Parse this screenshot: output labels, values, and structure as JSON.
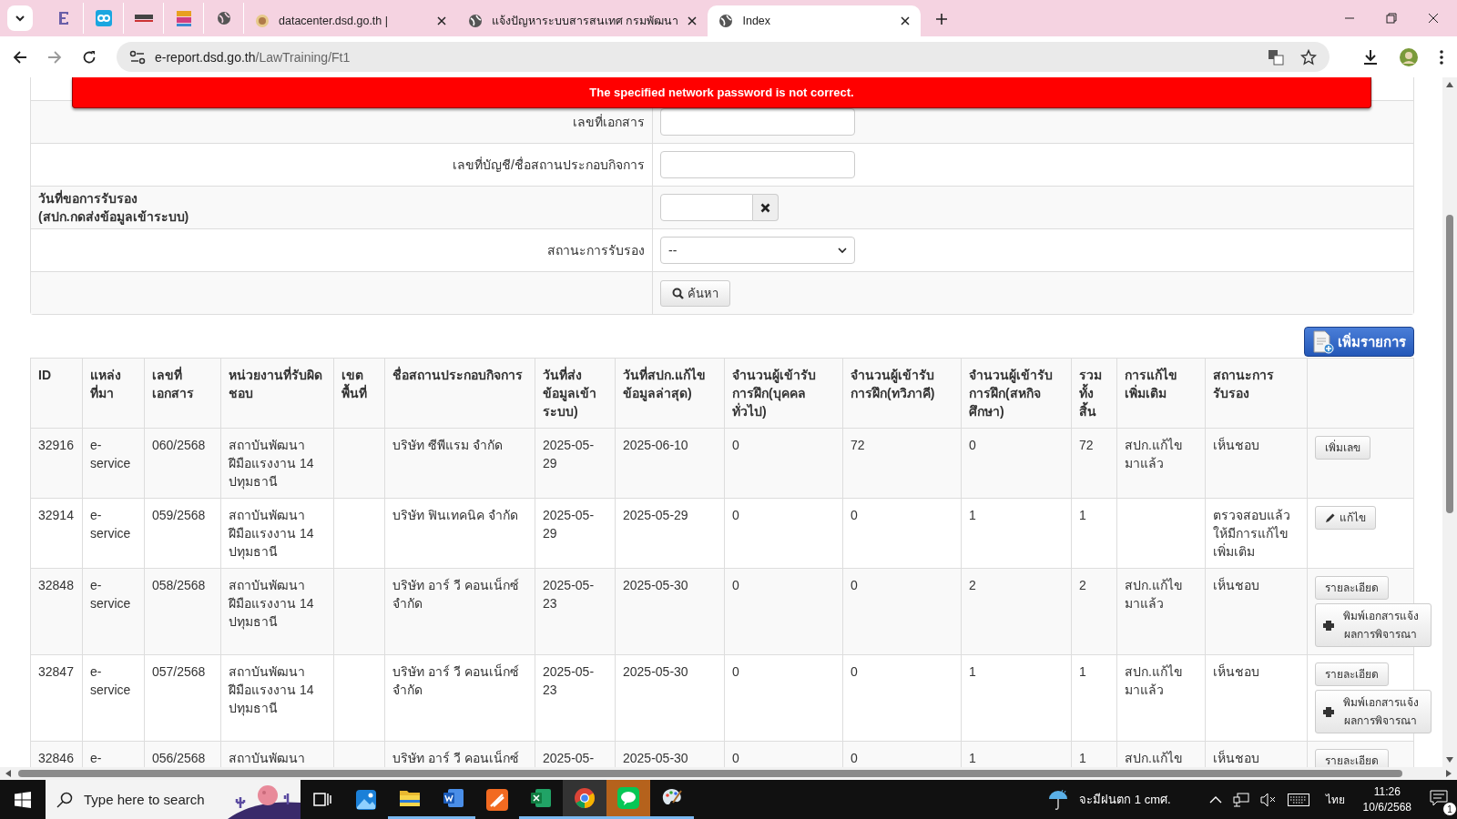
{
  "browser": {
    "tabs": [
      {
        "kind": "pinned",
        "selected": false
      },
      {
        "kind": "pinned",
        "selected": false
      },
      {
        "kind": "pinned",
        "selected": false
      },
      {
        "kind": "pinned",
        "selected": false
      },
      {
        "kind": "pinned",
        "selected": false
      },
      {
        "kind": "page",
        "title": "datacenter.dsd.go.th |",
        "selected": false
      },
      {
        "kind": "page",
        "title": "แจ้งปัญหาระบบสารสนเทศ กรมพัฒนา",
        "selected": false
      },
      {
        "kind": "page",
        "title": "Index",
        "selected": true
      }
    ],
    "url": {
      "host": "e-report.dsd.go.th",
      "path": "/LawTraining/Ft1"
    }
  },
  "alert": {
    "message": "The specified network password is not correct."
  },
  "form": {
    "rows": [
      {
        "kind": "text",
        "label_lines": [
          "เลขที่เอกสาร"
        ],
        "value": ""
      },
      {
        "kind": "text",
        "label_lines": [
          "เลขที่บัญชี/ชื่อสถานประกอบกิจการ"
        ],
        "value": ""
      },
      {
        "kind": "date",
        "label_lines": [
          "วันที่ขอการรับรอง",
          "(สปก.กดส่งข้อมูลเข้าระบบ)"
        ],
        "value": ""
      },
      {
        "kind": "select",
        "label_lines": [
          "สถานะการรับรอง"
        ],
        "value": "--"
      },
      {
        "kind": "button",
        "button": "ค้นหา"
      }
    ]
  },
  "add_button": "เพิ่มรายการ",
  "table": {
    "columns": [
      "ID",
      "แหล่งที่มา",
      "เลขที่เอกสาร",
      "หน่วยงานที่รับผิดชอบ",
      "เขตพื้นที่",
      "ชื่อสถานประกอบกิจการ",
      "วันที่ส่งข้อมูลเข้าระบบ)",
      "วันที่สปก.แก้ไขข้อมูลล่าสุด)",
      "จำนวนผู้เข้ารับการฝึก(บุคคลทั่วไป)",
      "จำนวนผู้เข้ารับการฝึก(ทวิภาคี)",
      "จำนวนผู้เข้ารับการฝึก(สหกิจศึกษา)",
      "รวมทั้งสิ้น",
      "การแก้ไขเพิ่มเติม",
      "สถานะการรับรอง"
    ],
    "rows": [
      {
        "cells": [
          "32916",
          "e-service",
          "060/2568",
          "สถาบันพัฒนาฝีมือแรงงาน 14 ปทุมธานี",
          "",
          "บริษัท ซีพีแรม จำกัด",
          "2025-05-29",
          "2025-06-10",
          "0",
          "72",
          "0",
          "72",
          "สปก.แก้ไขมาแล้ว",
          "เห็นชอบ"
        ],
        "actions": [
          {
            "kind": "plain",
            "label": "เพิ่มเลข"
          }
        ]
      },
      {
        "cells": [
          "32914",
          "e-service",
          "059/2568",
          "สถาบันพัฒนาฝีมือแรงงาน 14 ปทุมธานี",
          "",
          "บริษัท ฟินเทคนิค จำกัด",
          "2025-05-29",
          "2025-05-29",
          "0",
          "0",
          "1",
          "1",
          "",
          "ตรวจสอบแล้วให้มีการแก้ไขเพิ่มเติม"
        ],
        "actions": [
          {
            "kind": "edit",
            "label": "แก้ไข"
          }
        ]
      },
      {
        "cells": [
          "32848",
          "e-service",
          "058/2568",
          "สถาบันพัฒนาฝีมือแรงงาน 14 ปทุมธานี",
          "",
          "บริษัท อาร์ วี คอนเน็กซ์ จำกัด",
          "2025-05-23",
          "2025-05-30",
          "0",
          "0",
          "2",
          "2",
          "สปก.แก้ไขมาแล้ว",
          "เห็นชอบ"
        ],
        "actions": [
          {
            "kind": "plain",
            "label": "รายละเอียด"
          },
          {
            "kind": "print",
            "label": "พิมพ์เอกสารแจ้งผลการพิจารณา"
          }
        ]
      },
      {
        "cells": [
          "32847",
          "e-service",
          "057/2568",
          "สถาบันพัฒนาฝีมือแรงงาน 14 ปทุมธานี",
          "",
          "บริษัท อาร์ วี คอนเน็กซ์ จำกัด",
          "2025-05-23",
          "2025-05-30",
          "0",
          "0",
          "1",
          "1",
          "สปก.แก้ไขมาแล้ว",
          "เห็นชอบ"
        ],
        "actions": [
          {
            "kind": "plain",
            "label": "รายละเอียด"
          },
          {
            "kind": "print",
            "label": "พิมพ์เอกสารแจ้งผลการพิจารณา"
          }
        ]
      },
      {
        "cells": [
          "32846",
          "e-",
          "056/2568",
          "สถาบันพัฒนา",
          "",
          "บริษัท อาร์ วี คอนเน็กซ์",
          "2025-05-",
          "2025-05-30",
          "0",
          "0",
          "1",
          "1",
          "สปก.แก้ไข",
          "เห็นชอบ"
        ],
        "actions": [
          {
            "kind": "plain",
            "label": "รายละเอียด"
          }
        ]
      }
    ]
  },
  "taskbar": {
    "search_placeholder": "Type here to search",
    "apps": [
      {
        "kind": "taskview",
        "active": false,
        "running": false
      },
      {
        "kind": "photos",
        "active": false,
        "running": false
      },
      {
        "kind": "explorer",
        "active": false,
        "running": true
      },
      {
        "kind": "word",
        "active": false,
        "running": true
      },
      {
        "kind": "pen",
        "active": false,
        "running": false
      },
      {
        "kind": "excel",
        "active": false,
        "running": true
      },
      {
        "kind": "chrome",
        "active": true,
        "running": true
      },
      {
        "kind": "line",
        "active": false,
        "running": true,
        "flashing": true
      },
      {
        "kind": "paint",
        "active": false,
        "running": true
      }
    ],
    "weather": "จะมีฝนตก 1 cmศ.",
    "language": "ไทย",
    "time": "11:26",
    "date": "10/6/2568",
    "notifications": "1"
  }
}
